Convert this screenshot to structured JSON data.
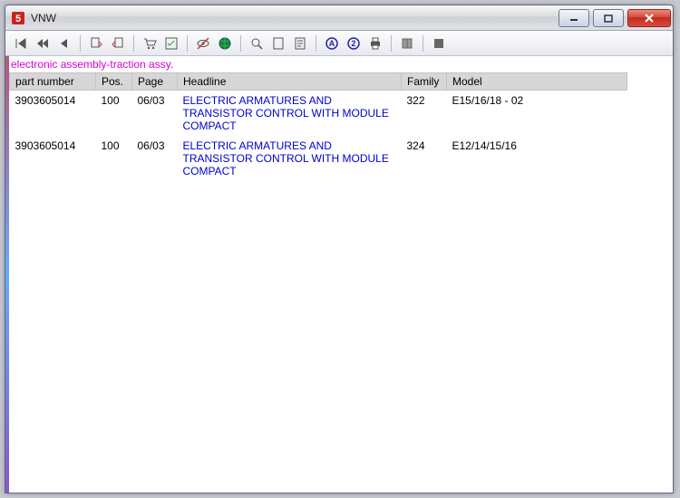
{
  "window": {
    "title": "VNW"
  },
  "heading": "electronic assembly-traction assy.",
  "columns": {
    "part_number": "part number",
    "pos": "Pos.",
    "page": "Page",
    "headline": "Headline",
    "family": "Family",
    "model": "Model"
  },
  "rows": [
    {
      "part_number": "3903605014",
      "pos": "100",
      "page": "06/03",
      "headline": "ELECTRIC ARMATURES AND TRANSISTOR CONTROL WITH MODULE COMPACT",
      "family": "322",
      "model": "E15/16/18 - 02"
    },
    {
      "part_number": "3903605014",
      "pos": "100",
      "page": "06/03",
      "headline": "ELECTRIC ARMATURES AND TRANSISTOR CONTROL WITH MODULE COMPACT",
      "family": "324",
      "model": "E12/14/15/16"
    }
  ],
  "toolbar_icons": [
    "nav-first-icon",
    "nav-rewind-icon",
    "nav-prev-icon",
    "doc-copy-icon",
    "doc-move-icon",
    "cart-icon",
    "checklist-icon",
    "eye-off-icon",
    "globe-icon",
    "zoom-icon",
    "page-icon",
    "page-text-icon",
    "a-circle-icon",
    "two-circle-icon",
    "print-icon",
    "book-icon",
    "stop-icon"
  ]
}
